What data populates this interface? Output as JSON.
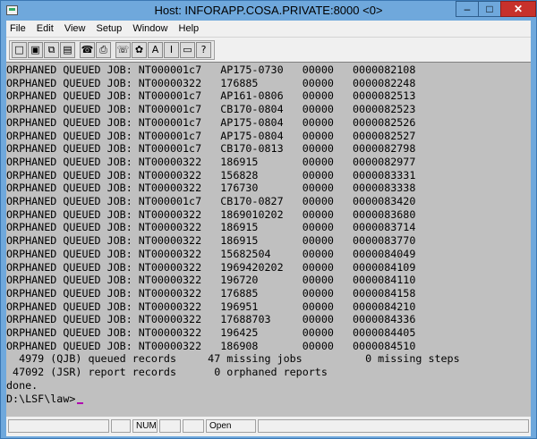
{
  "window": {
    "title": "Host: INFORAPP.COSA.PRIVATE:8000 <0>",
    "min_glyph": "–",
    "max_glyph": "□",
    "close_glyph": "✕"
  },
  "menu": [
    "File",
    "Edit",
    "View",
    "Setup",
    "Window",
    "Help"
  ],
  "toolbar": {
    "buttons": [
      {
        "name": "new-icon",
        "glyph": "□"
      },
      {
        "name": "save-icon",
        "glyph": "▣"
      },
      {
        "name": "copy-icon",
        "glyph": "⧉"
      },
      {
        "name": "paste-icon",
        "glyph": "▤"
      },
      {
        "name": "connect-icon",
        "glyph": "☎"
      },
      {
        "name": "print-icon",
        "glyph": "⎙"
      },
      {
        "name": "phone-icon",
        "glyph": "☏"
      },
      {
        "name": "color-icon",
        "glyph": "✿"
      },
      {
        "name": "font-icon",
        "glyph": "A"
      },
      {
        "name": "keyboard-map-icon",
        "glyph": "I"
      },
      {
        "name": "terminal-icon",
        "glyph": "▭"
      },
      {
        "name": "help-icon",
        "glyph": "?"
      }
    ]
  },
  "terminal": {
    "lines": [
      "ORPHANED QUEUED JOB: NT000001c7   AP175-0730   00000   0000082108",
      "ORPHANED QUEUED JOB: NT00000322   176885       00000   0000082248",
      "ORPHANED QUEUED JOB: NT000001c7   AP161-0806   00000   0000082513",
      "ORPHANED QUEUED JOB: NT000001c7   CB170-0804   00000   0000082523",
      "ORPHANED QUEUED JOB: NT000001c7   AP175-0804   00000   0000082526",
      "ORPHANED QUEUED JOB: NT000001c7   AP175-0804   00000   0000082527",
      "ORPHANED QUEUED JOB: NT000001c7   CB170-0813   00000   0000082798",
      "ORPHANED QUEUED JOB: NT00000322   186915       00000   0000082977",
      "ORPHANED QUEUED JOB: NT00000322   156828       00000   0000083331",
      "ORPHANED QUEUED JOB: NT00000322   176730       00000   0000083338",
      "ORPHANED QUEUED JOB: NT000001c7   CB170-0827   00000   0000083420",
      "ORPHANED QUEUED JOB: NT00000322   1869010202   00000   0000083680",
      "ORPHANED QUEUED JOB: NT00000322   186915       00000   0000083714",
      "ORPHANED QUEUED JOB: NT00000322   186915       00000   0000083770",
      "ORPHANED QUEUED JOB: NT00000322   15682504     00000   0000084049",
      "ORPHANED QUEUED JOB: NT00000322   1969420202   00000   0000084109",
      "ORPHANED QUEUED JOB: NT00000322   196720       00000   0000084110",
      "ORPHANED QUEUED JOB: NT00000322   176885       00000   0000084158",
      "ORPHANED QUEUED JOB: NT00000322   196951       00000   0000084210",
      "ORPHANED QUEUED JOB: NT00000322   17688703     00000   0000084336",
      "ORPHANED QUEUED JOB: NT00000322   196425       00000   0000084405",
      "ORPHANED QUEUED JOB: NT00000322   186908       00000   0000084510",
      "  4979 (QJB) queued records     47 missing jobs          0 missing steps",
      " 47092 (JSR) report records      0 orphaned reports",
      "done.",
      "D:\\LSF\\law>"
    ]
  },
  "status": {
    "num": "NUM",
    "mode": "Open"
  }
}
